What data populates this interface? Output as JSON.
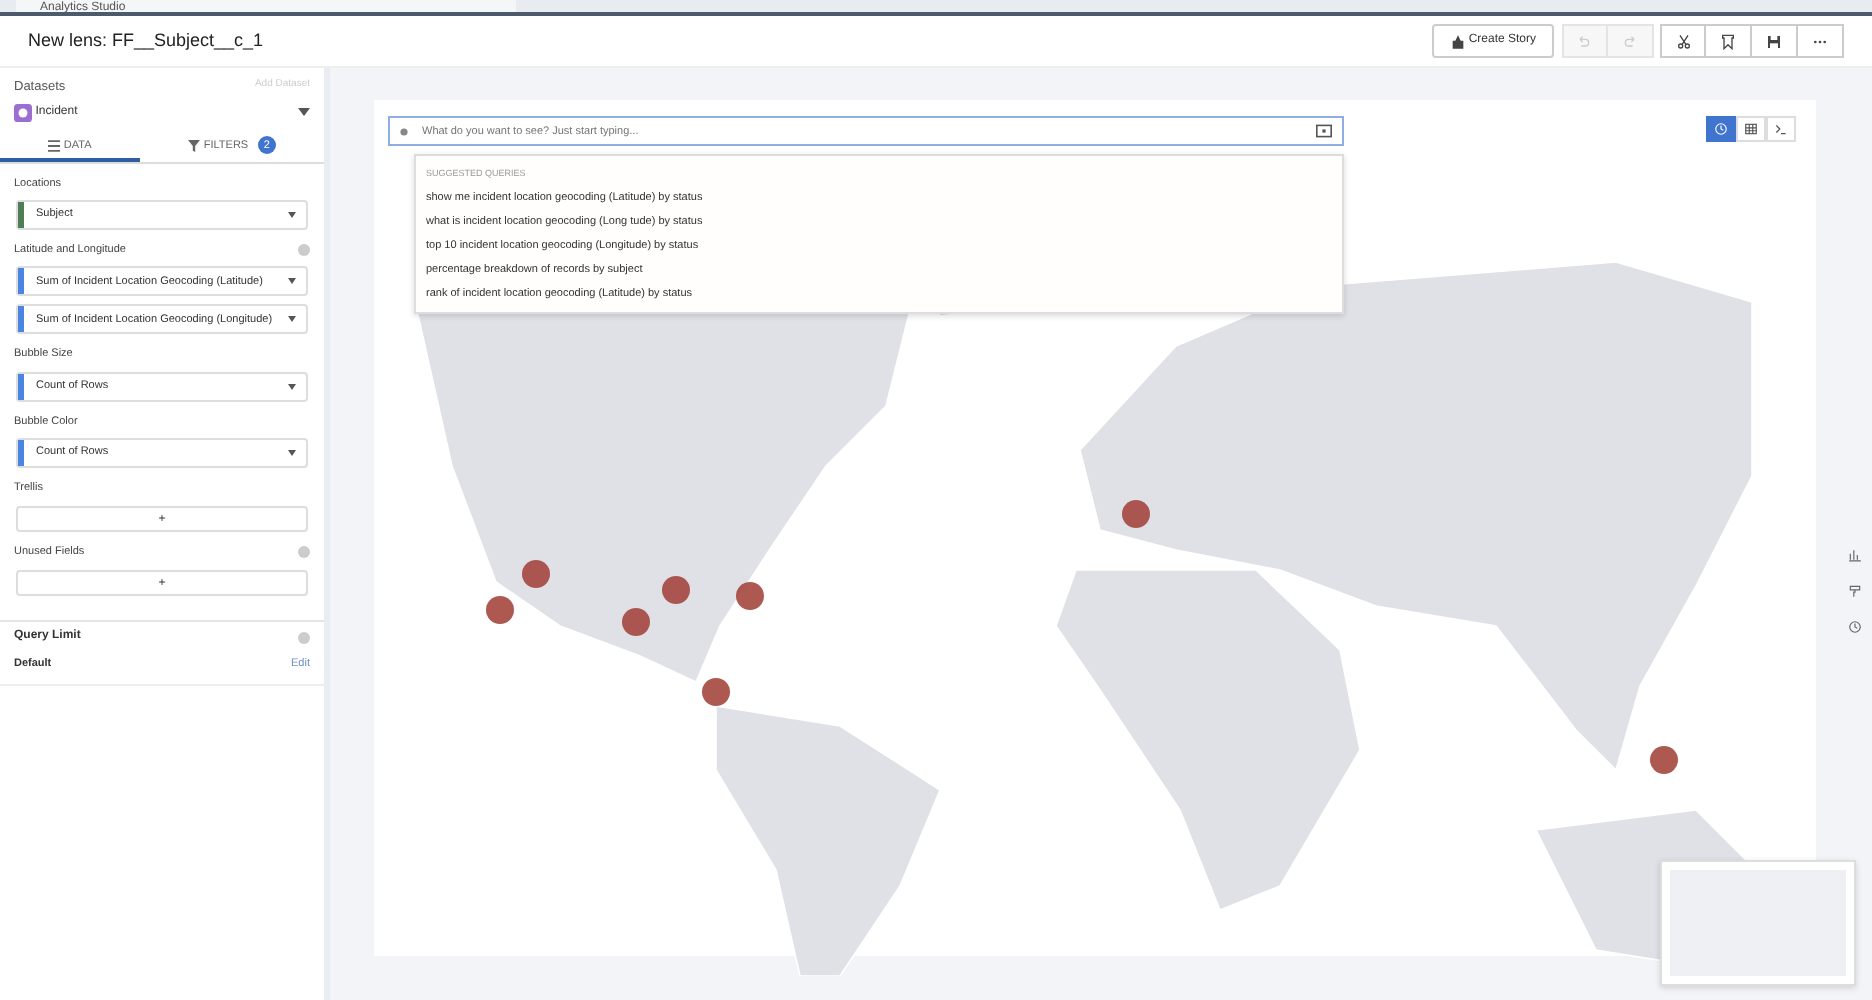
{
  "browser_tab": {
    "title": "Analytics Studio"
  },
  "header": {
    "title": "New lens: FF__Subject__c_1",
    "create_story": "Create Story",
    "actions": [
      {
        "kind": "undo",
        "disabled": true
      },
      {
        "kind": "redo",
        "disabled": true
      },
      {
        "kind": "cut",
        "disabled": false
      },
      {
        "kind": "bookmark",
        "disabled": false
      },
      {
        "kind": "save",
        "disabled": false
      },
      {
        "kind": "more",
        "disabled": false
      }
    ]
  },
  "sidebar": {
    "datasets_label": "Datasets",
    "add_dataset": "Add Dataset",
    "dataset": "Incident",
    "tabs": [
      {
        "kind": "data",
        "label": "DATA",
        "selected": true
      },
      {
        "kind": "filters",
        "label": "FILTERS",
        "badge": "2",
        "selected": false
      }
    ],
    "sections": [
      {
        "title": "Locations",
        "info": false,
        "fields": [
          {
            "label": "Subject",
            "color": "#4e7d57"
          }
        ]
      },
      {
        "title": "Latitude and Longitude",
        "info": true,
        "fields": [
          {
            "label": "Sum of Incident Location Geocoding (Latitude)",
            "color": "#4a86e0"
          },
          {
            "label": "Sum of Incident Location Geocoding (Longitude)",
            "color": "#4a86e0"
          }
        ]
      },
      {
        "title": "Bubble Size",
        "info": false,
        "fields": [
          {
            "label": "Count of Rows",
            "color": "#4a86e0"
          }
        ]
      },
      {
        "title": "Bubble Color",
        "info": false,
        "fields": [
          {
            "label": "Count of Rows",
            "color": "#4a86e0"
          }
        ]
      },
      {
        "title": "Trellis",
        "info": false,
        "add": "+"
      },
      {
        "title": "Unused Fields",
        "info": true,
        "add": "+"
      }
    ],
    "query_limit": {
      "title": "Query Limit",
      "value": "Default",
      "action": "Edit"
    }
  },
  "search": {
    "placeholder": "What do you want to see? Just start typing...",
    "suggestions_heading": "SUGGESTED QUERIES",
    "suggestions": [
      "show me incident location geocoding (Latitude) by status",
      "what is incident location geocoding (Long tude) by status",
      "top 10 incident location geocoding (Longitude) by status",
      "percentage breakdown of records by subject",
      "rank of incident location geocoding (Latitude) by status"
    ]
  },
  "view_toggle": [
    {
      "kind": "chart",
      "selected": true
    },
    {
      "kind": "table",
      "selected": false
    },
    {
      "kind": "query",
      "selected": false
    }
  ],
  "right_rail": [
    {
      "kind": "chart"
    },
    {
      "kind": "format"
    },
    {
      "kind": "history"
    }
  ]
}
